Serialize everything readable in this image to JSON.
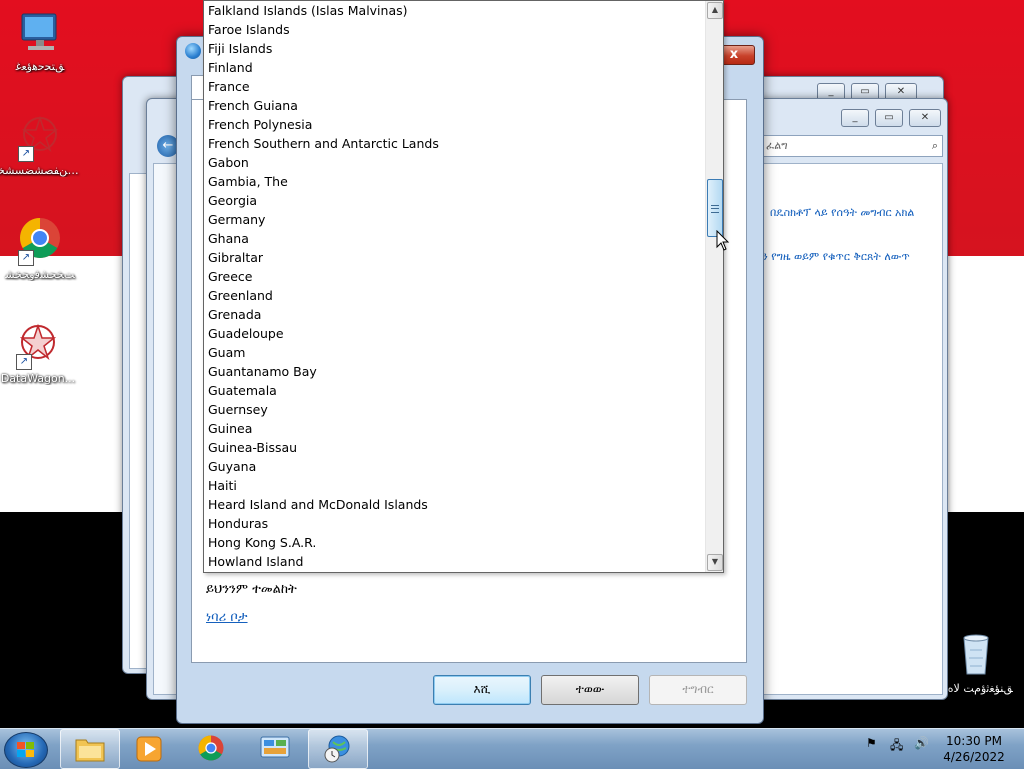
{
  "desktop": {
    "icons": [
      {
        "label": "ﻖﺘﺤﺣﻫؤﻌﻏ"
      },
      {
        "label": "يسنﻔﺼﺸﻀﺴﺸﺨ..."
      },
      {
        "label": "ﺖﺨﺤﺸﻓوﺤﺨﺸ"
      },
      {
        "label": "DataWagon..."
      },
      {
        "label": "ﻖﻨﺆﻐﺛؤمﺖ ﻻهﻯ"
      }
    ]
  },
  "background_window": {
    "search_placeholder": "ፈልግ",
    "link1": "በዴስክቶፕ ላይ የሰዓት መግብር አክል",
    "link2": "ን የግዜ ወይም የቁጥር ቅርጸት ለውጥ"
  },
  "dialog": {
    "close_label": "x",
    "show_this_label": "ይህንንም ተመልከት",
    "default_location_link": "ነባሪ ቦታ",
    "buttons": {
      "ok": "እሺ",
      "cancel": "ተወው",
      "apply": "ተግብር"
    },
    "country_list": [
      "Falkland Islands (Islas Malvinas)",
      "Faroe Islands",
      "Fiji Islands",
      "Finland",
      "France",
      "French Guiana",
      "French Polynesia",
      "French Southern and Antarctic Lands",
      "Gabon",
      "Gambia, The",
      "Georgia",
      "Germany",
      "Ghana",
      "Gibraltar",
      "Greece",
      "Greenland",
      "Grenada",
      "Guadeloupe",
      "Guam",
      "Guantanamo Bay",
      "Guatemala",
      "Guernsey",
      "Guinea",
      "Guinea-Bissau",
      "Guyana",
      "Haiti",
      "Heard Island and McDonald Islands",
      "Honduras",
      "Hong Kong S.A.R.",
      "Howland Island"
    ]
  },
  "taskbar": {
    "clock_time": "10:30 PM",
    "clock_date": "4/26/2022"
  },
  "colors": {
    "flag_red": "#e30e1f",
    "flag_white": "#ffffff",
    "flag_black": "#000000",
    "link_blue": "#1560bd"
  }
}
